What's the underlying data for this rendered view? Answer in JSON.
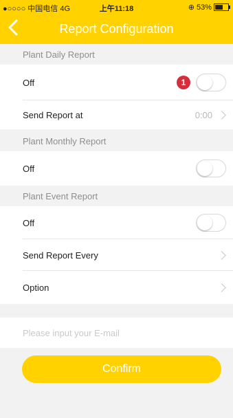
{
  "status_bar": {
    "carrier": "●○○○○ 中国电信 4G",
    "time": "上午11:18",
    "battery_text": "⊕ 53%",
    "battery_level": 0.53
  },
  "nav": {
    "back_icon": "chevron-left-icon",
    "title": "Report Configuration"
  },
  "sections": {
    "daily": {
      "header": "Plant Daily Report",
      "toggle_label": "Off",
      "badge": "1",
      "send_at_label": "Send Report at",
      "send_at_value": "0:00"
    },
    "monthly": {
      "header": "Plant Monthly Report",
      "toggle_label": "Off"
    },
    "event": {
      "header": "Plant Event Report",
      "toggle_label": "Off",
      "send_every_label": "Send Report Every",
      "option_label": "Option"
    }
  },
  "email": {
    "placeholder": "Please input your E-mail",
    "value": ""
  },
  "confirm_label": "Confirm",
  "colors": {
    "accent": "#ffd200",
    "badge": "#d72e3c",
    "background": "#f2f2f2"
  }
}
